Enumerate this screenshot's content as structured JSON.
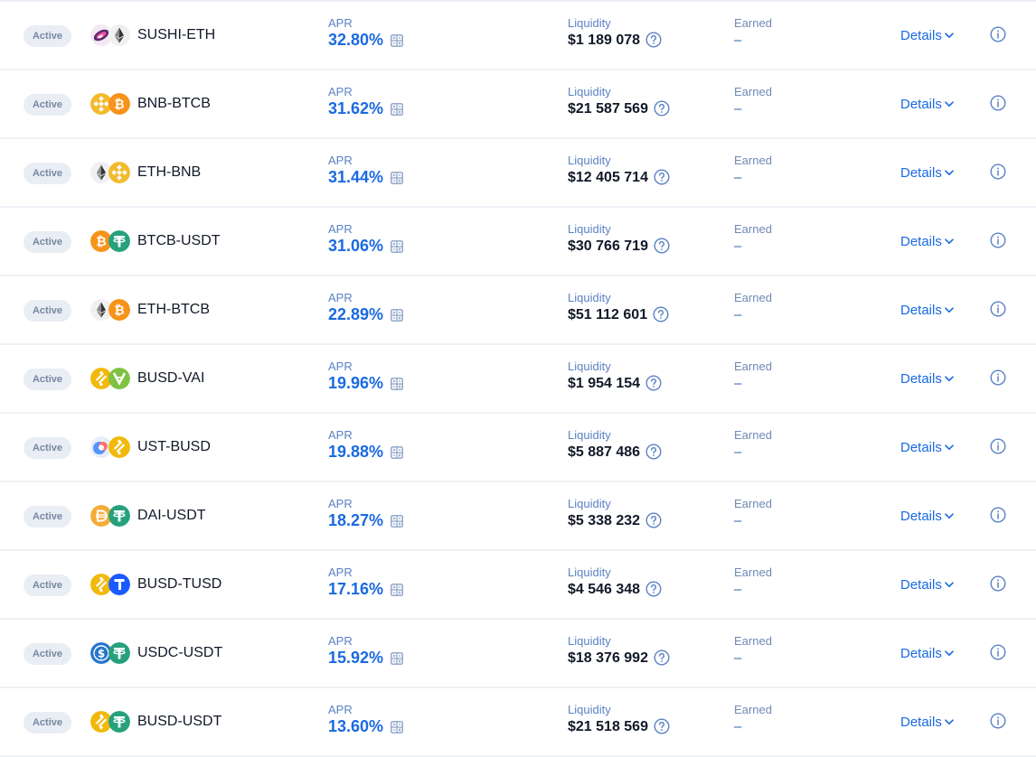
{
  "labels": {
    "status": "Active",
    "apr": "APR",
    "liquidity": "Liquidity",
    "earned": "Earned",
    "details": "Details"
  },
  "farms": [
    {
      "pair": "SUSHI-ETH",
      "apr": "32.80%",
      "liquidity": "$1 189 078",
      "earned": "–",
      "tokens": [
        "sushi-icon",
        "eth-icon"
      ]
    },
    {
      "pair": "BNB-BTCB",
      "apr": "31.62%",
      "liquidity": "$21 587 569",
      "earned": "–",
      "tokens": [
        "bnb-icon",
        "btcb-icon"
      ]
    },
    {
      "pair": "ETH-BNB",
      "apr": "31.44%",
      "liquidity": "$12 405 714",
      "earned": "–",
      "tokens": [
        "eth-icon",
        "bnb-icon"
      ]
    },
    {
      "pair": "BTCB-USDT",
      "apr": "31.06%",
      "liquidity": "$30 766 719",
      "earned": "–",
      "tokens": [
        "btcb-icon",
        "usdt-icon"
      ]
    },
    {
      "pair": "ETH-BTCB",
      "apr": "22.89%",
      "liquidity": "$51 112 601",
      "earned": "–",
      "tokens": [
        "eth-icon",
        "btcb-icon"
      ]
    },
    {
      "pair": "BUSD-VAI",
      "apr": "19.96%",
      "liquidity": "$1 954 154",
      "earned": "–",
      "tokens": [
        "busd-icon",
        "vai-icon"
      ]
    },
    {
      "pair": "UST-BUSD",
      "apr": "19.88%",
      "liquidity": "$5 887 486",
      "earned": "–",
      "tokens": [
        "ust-icon",
        "busd-icon"
      ]
    },
    {
      "pair": "DAI-USDT",
      "apr": "18.27%",
      "liquidity": "$5 338 232",
      "earned": "–",
      "tokens": [
        "dai-icon",
        "usdt-icon"
      ]
    },
    {
      "pair": "BUSD-TUSD",
      "apr": "17.16%",
      "liquidity": "$4 546 348",
      "earned": "–",
      "tokens": [
        "busd-icon",
        "tusd-icon"
      ]
    },
    {
      "pair": "USDC-USDT",
      "apr": "15.92%",
      "liquidity": "$18 376 992",
      "earned": "–",
      "tokens": [
        "usdc-icon",
        "usdt-icon"
      ]
    },
    {
      "pair": "BUSD-USDT",
      "apr": "13.60%",
      "liquidity": "$21 518 569",
      "earned": "–",
      "tokens": [
        "busd-icon",
        "usdt-icon"
      ]
    }
  ],
  "colors": {
    "accent": "#1a6ae0",
    "label": "#5b82c4",
    "badge_bg": "#e9edf4",
    "badge_text": "#7787a3",
    "divider": "#eef1f6"
  }
}
